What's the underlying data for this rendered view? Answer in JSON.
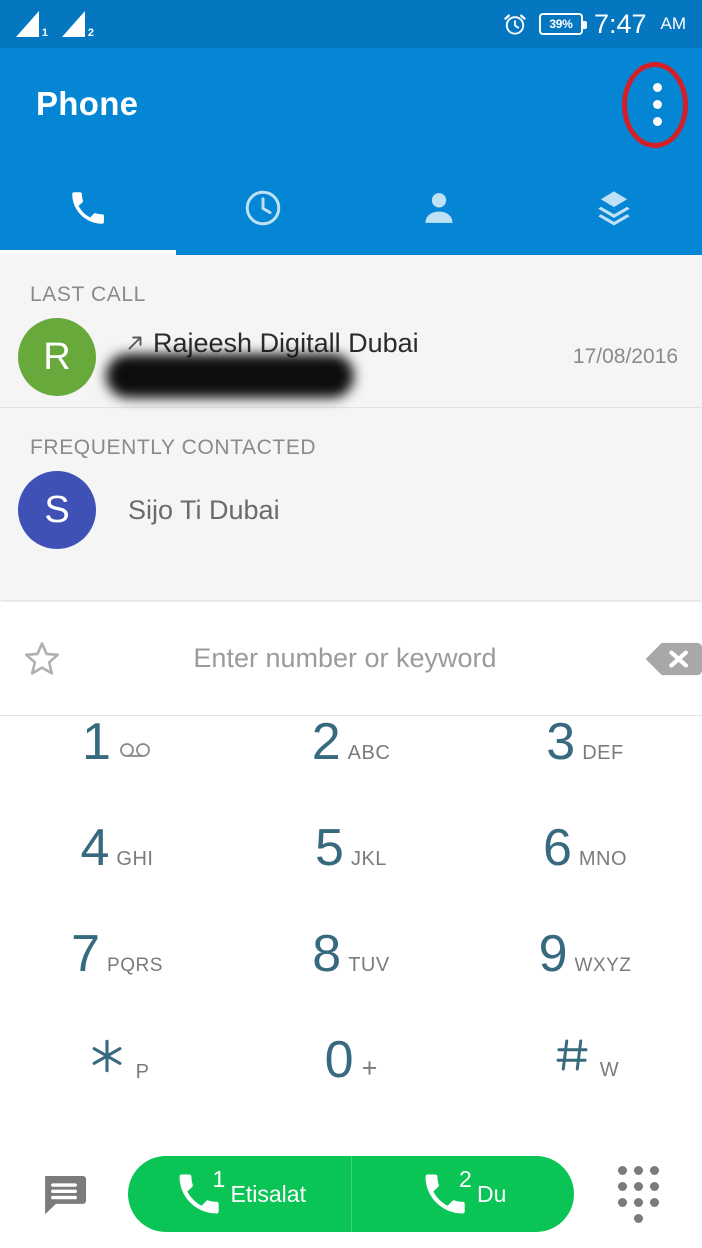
{
  "status_bar": {
    "sim1_label": "1",
    "sim2_label": "2",
    "alarm_icon": "alarm-clock-icon",
    "battery_percent": "39%",
    "time": "7:47",
    "ampm": "AM"
  },
  "app_bar": {
    "title": "Phone",
    "overflow_icon": "more-vertical-icon",
    "annotation_color": "#d41f28"
  },
  "tabs": [
    {
      "name": "dialer",
      "icon": "phone-icon",
      "active": true
    },
    {
      "name": "recents",
      "icon": "clock-icon",
      "active": false
    },
    {
      "name": "contacts",
      "icon": "person-icon",
      "active": false
    },
    {
      "name": "groups",
      "icon": "layers-icon",
      "active": false
    }
  ],
  "sections": [
    {
      "label": "LAST CALL",
      "rows": [
        {
          "avatar_letter": "R",
          "avatar_color": "#67a93b",
          "call_type_icon": "outgoing-call-arrow-icon",
          "name": "Rajeesh Digitall Dubai",
          "number": "",
          "number_redacted": true,
          "date": "17/08/2016"
        }
      ]
    },
    {
      "label": "FREQUENTLY CONTACTED",
      "rows": [
        {
          "avatar_letter": "S",
          "avatar_color": "#3f51b5",
          "name": "Sijo Ti Dubai",
          "number": "",
          "date": ""
        }
      ]
    }
  ],
  "search": {
    "star_icon": "star-outline-icon",
    "placeholder": "Enter number or keyword",
    "value": "",
    "backspace_icon": "backspace-icon"
  },
  "keypad": {
    "digit_color": "#37697f",
    "keys": [
      {
        "digit": "1",
        "letters": "",
        "icon": "voicemail-icon"
      },
      {
        "digit": "2",
        "letters": "ABC",
        "icon": ""
      },
      {
        "digit": "3",
        "letters": "DEF",
        "icon": ""
      },
      {
        "digit": "4",
        "letters": "GHI",
        "icon": ""
      },
      {
        "digit": "5",
        "letters": "JKL",
        "icon": ""
      },
      {
        "digit": "6",
        "letters": "MNO",
        "icon": ""
      },
      {
        "digit": "7",
        "letters": "PQRS",
        "icon": ""
      },
      {
        "digit": "8",
        "letters": "TUV",
        "icon": ""
      },
      {
        "digit": "9",
        "letters": "WXYZ",
        "icon": ""
      },
      {
        "digit": "✳",
        "letters": "P",
        "icon": ""
      },
      {
        "digit": "0",
        "letters": "+",
        "icon": ""
      },
      {
        "digit": "#",
        "letters": "W",
        "icon": ""
      }
    ]
  },
  "bottom_bar": {
    "message_icon": "message-icon",
    "call_color": "#0ac455",
    "call_buttons": [
      {
        "sim": "1",
        "label": "Etisalat",
        "icon": "phone-icon"
      },
      {
        "sim": "2",
        "label": "Du",
        "icon": "phone-icon"
      }
    ],
    "keypad_icon": "dialpad-icon"
  }
}
